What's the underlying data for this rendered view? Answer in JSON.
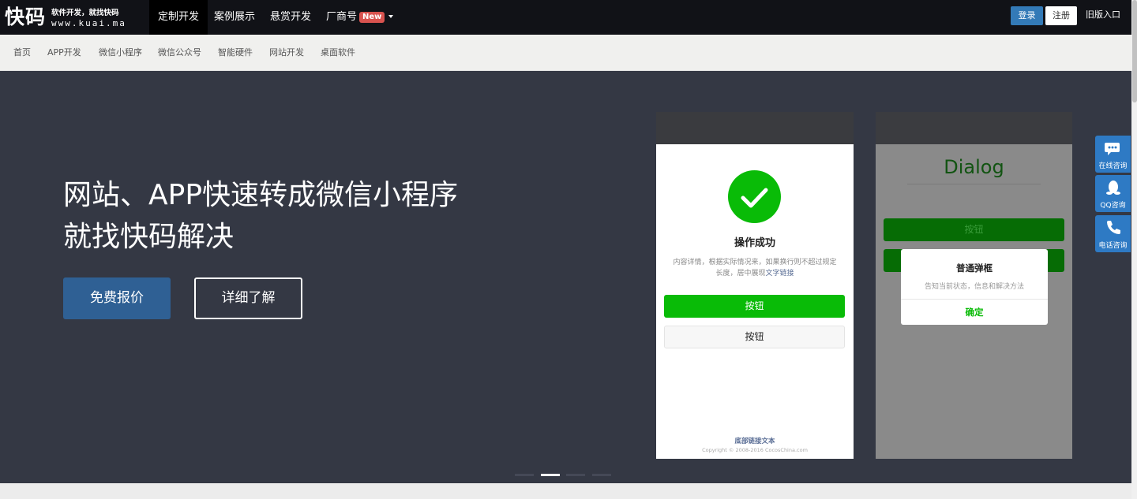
{
  "header": {
    "logo_main": "快码",
    "logo_sub": "软件开发，就找快码",
    "logo_url": "www.kuai.ma",
    "nav": [
      {
        "label": "定制开发",
        "active": true
      },
      {
        "label": "案例展示",
        "active": false
      },
      {
        "label": "悬赏开发",
        "active": false
      },
      {
        "label": "厂商号",
        "active": false,
        "badge": "New"
      }
    ],
    "login_label": "登录",
    "register_label": "注册",
    "old_entry_label": "旧版入口"
  },
  "subnav": {
    "items": [
      "首页",
      "APP开发",
      "微信小程序",
      "微信公众号",
      "智能硬件",
      "网站开发",
      "桌面软件"
    ]
  },
  "hero": {
    "title_line1": "网站、APP快速转成微信小程序",
    "title_line2": "就找快码解决",
    "quote_button": "免费报价",
    "detail_button": "详细了解",
    "carousel_active_index": 1
  },
  "phone1": {
    "title": "操作成功",
    "desc": "内容详情，根据实际情况来，如果换行则不超过规定长度，居中展现",
    "desc_link": "文字链接",
    "btn_primary": "按钮",
    "btn_default": "按钮",
    "footer_link": "底部链接文本",
    "copyright": "Copyright © 2008-2016 CocosChina.com"
  },
  "phone2": {
    "title": "Dialog",
    "btn_primary": "按钮",
    "modal_title": "普通弹框",
    "modal_text": "告知当前状态，信息和解决方法",
    "modal_ok": "确定"
  },
  "side": {
    "online_label": "在线咨询",
    "qq_label": "QQ咨询",
    "phone_label": "电话咨询"
  },
  "colors": {
    "topbar": "#111217",
    "hero_bg": "#343844",
    "primary_blue": "#2f6094",
    "wechat_green": "#09bb07",
    "badge_red": "#d9534f",
    "side_blue": "#2e7ac4"
  }
}
